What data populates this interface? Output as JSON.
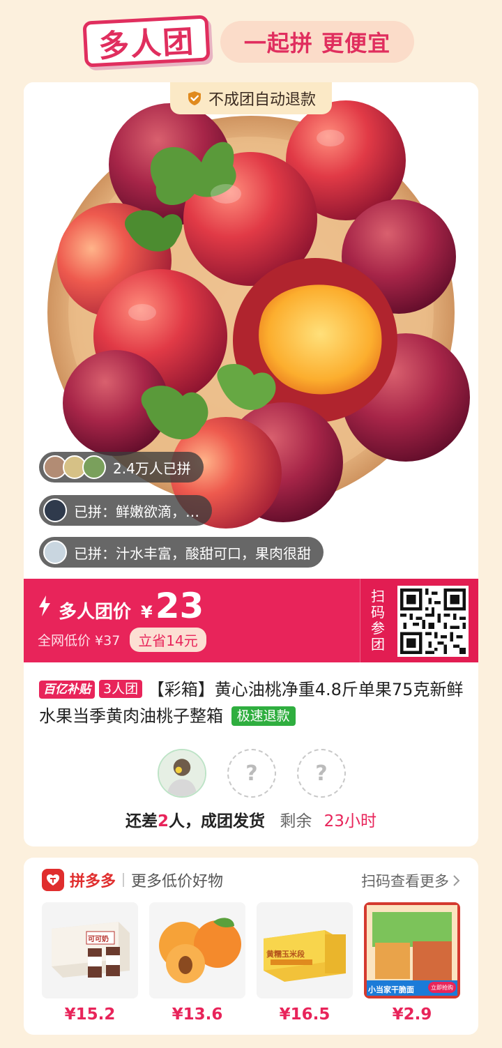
{
  "header": {
    "logo_text": "多人团",
    "slogan": "一起拼 更便宜"
  },
  "product": {
    "refund_badge": "不成团自动退款",
    "joined_count": "2.4万人已拼",
    "reviews": [
      "已拼：鲜嫩欲滴，…",
      "已拼：汁水丰富，酸甜可口，果肉很甜"
    ],
    "price_label": "多人团价",
    "currency": "¥",
    "price": "23",
    "original_price": "全网低价 ¥37",
    "save_tag": "立省14元",
    "scan_label": "扫码参团",
    "tag_subsidy": "百亿补贴",
    "tag_group": "3人团",
    "title": "【彩箱】黄心油桃净重4.8斤单果75克新鲜水果当季黄肉油桃子整箱",
    "tag_refund": "极速退款",
    "status_prefix": "还差",
    "status_count": "2",
    "status_suffix": "人，成团发货",
    "remaining_label": "剩余",
    "remaining_time": "23小时",
    "empty_slot": "?"
  },
  "recommend": {
    "brand": "拼多多",
    "subtitle": "更多低价好物",
    "more_link": "扫码查看更多",
    "items": [
      {
        "price": "¥15.2",
        "thumb_text": "可可奶"
      },
      {
        "price": "¥13.6"
      },
      {
        "price": "¥16.5",
        "thumb_text": "黄糯玉米段"
      },
      {
        "price": "¥2.9",
        "thumb_text": "小当家干脆面",
        "thumb_btn": "立即抢购"
      }
    ]
  },
  "colors": {
    "brand_red": "#e8245a",
    "background": "#fcf0dd",
    "refund_green": "#2fae3f"
  }
}
